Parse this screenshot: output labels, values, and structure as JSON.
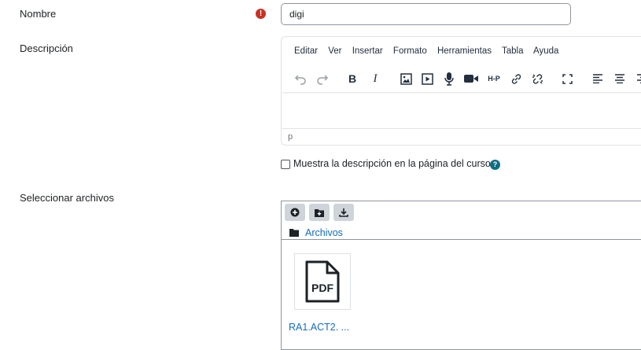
{
  "fields": {
    "name_label": "Nombre",
    "name_value": "digi",
    "required_icon": "!",
    "description_label": "Descripción",
    "select_files_label": "Seleccionar archivos"
  },
  "editor": {
    "menu": [
      "Editar",
      "Ver",
      "Insertar",
      "Formato",
      "Herramientas",
      "Tabla",
      "Ayuda"
    ],
    "toolbar_icons": [
      "undo-icon",
      "redo-icon",
      "bold-icon",
      "italic-icon",
      "image-icon",
      "media-icon",
      "microphone-icon",
      "video-icon",
      "h5p-icon",
      "link-icon",
      "unlink-icon",
      "fullscreen-icon",
      "align-left-icon",
      "align-center-icon",
      "align-right-icon"
    ],
    "bold": "B",
    "italic": "I",
    "h5p": "H-P",
    "status_path": "p"
  },
  "show_description": {
    "checked": false,
    "label": "Muestra la descripción en la página del curso",
    "help_icon": "?"
  },
  "filepicker": {
    "buttons": [
      "add-file-icon",
      "create-folder-icon",
      "download-icon"
    ],
    "path_label": "Archivos",
    "files": [
      {
        "name": "RA1.ACT2. ...",
        "icon_text": "PDF",
        "icon": "pdf-file-icon"
      }
    ]
  }
}
